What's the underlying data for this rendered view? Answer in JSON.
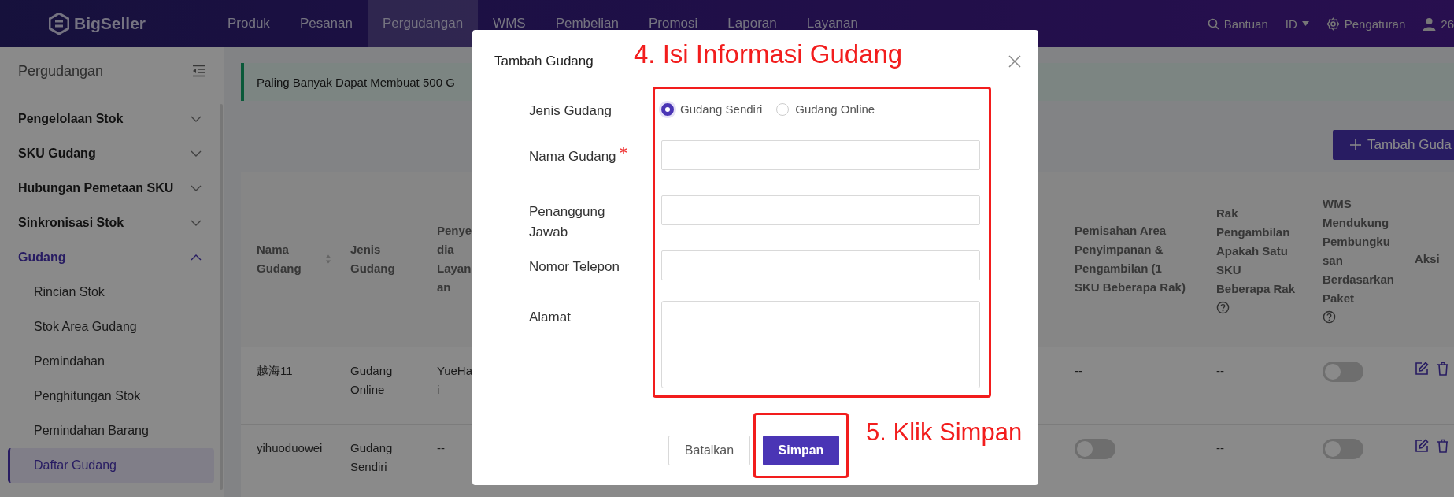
{
  "brand": {
    "name": "BigSeller"
  },
  "nav": [
    {
      "label": "Produk",
      "selected": false
    },
    {
      "label": "Pesanan",
      "selected": false
    },
    {
      "label": "Pergudangan",
      "selected": true
    },
    {
      "label": "WMS",
      "selected": false
    },
    {
      "label": "Pembelian",
      "selected": false
    },
    {
      "label": "Promosi",
      "selected": false
    },
    {
      "label": "Laporan",
      "selected": false
    },
    {
      "label": "Layanan",
      "selected": false
    }
  ],
  "header_tools": {
    "help": "Bantuan",
    "language": "ID",
    "settings": "Pengaturan",
    "user": "26"
  },
  "sidebar": {
    "title": "Pergudangan",
    "items": [
      {
        "label": "Pengelolaan Stok",
        "expanded": false
      },
      {
        "label": "SKU Gudang",
        "expanded": false
      },
      {
        "label": "Hubungan Pemetaan SKU",
        "expanded": false
      },
      {
        "label": "Sinkronisasi Stok",
        "expanded": false
      },
      {
        "label": "Gudang",
        "expanded": true,
        "children": [
          {
            "label": "Rincian Stok",
            "selected": false
          },
          {
            "label": "Stok Area Gudang",
            "selected": false
          },
          {
            "label": "Pemindahan",
            "selected": false
          },
          {
            "label": "Penghitungan Stok",
            "selected": false
          },
          {
            "label": "Pemindahan Barang",
            "selected": false
          },
          {
            "label": "Daftar Gudang",
            "selected": true
          }
        ]
      }
    ]
  },
  "alert": "Paling Banyak Dapat Membuat 500 G",
  "add_button": "Tambah Guda",
  "table": {
    "columns": [
      {
        "label": "Nama Gudang",
        "kind": "sortable"
      },
      {
        "label": "Jenis Gudang",
        "kind": "plain"
      },
      {
        "label": "Penyedia Layanan",
        "kind": "plain"
      },
      {
        "label": "Pemisahan Area Penyimpanan & Pengambilan (1 SKU Beberapa Rak)",
        "kind": "plain"
      },
      {
        "label": "Rak Pengambilan Apakah Satu SKU Beberapa Rak",
        "kind": "help"
      },
      {
        "label": "WMS Mendukung Pembungkusan Berdasarkan Paket",
        "kind": "help"
      },
      {
        "label": "Aksi",
        "kind": "plain"
      }
    ],
    "rows": [
      {
        "cells": [
          {
            "kind": "text",
            "text": "越海11"
          },
          {
            "kind": "text",
            "text": "Gudang Online"
          },
          {
            "kind": "text",
            "text": "YueHai"
          },
          {
            "kind": "text",
            "text": "--"
          },
          {
            "kind": "text",
            "text": "--"
          },
          {
            "kind": "toggle",
            "on": false
          },
          {
            "kind": "actions"
          }
        ]
      },
      {
        "cells": [
          {
            "kind": "text",
            "text": "yihuoduowei"
          },
          {
            "kind": "text",
            "text": "Gudang Sendiri"
          },
          {
            "kind": "text",
            "text": "--"
          },
          {
            "kind": "toggle",
            "on": false
          },
          {
            "kind": "text",
            "text": "--"
          },
          {
            "kind": "toggle",
            "on": false
          },
          {
            "kind": "actions"
          }
        ]
      }
    ]
  },
  "dialog": {
    "title": "Tambah Gudang",
    "fields": [
      {
        "kind": "radio",
        "label": "Jenis Gudang",
        "required": false,
        "options": [
          {
            "label": "Gudang Sendiri",
            "selected": true
          },
          {
            "label": "Gudang Online",
            "selected": false
          }
        ]
      },
      {
        "kind": "input",
        "label": "Nama Gudang",
        "required": true
      },
      {
        "kind": "input",
        "label": "Penanggung Jawab",
        "required": false
      },
      {
        "kind": "input",
        "label": "Nomor Telepon",
        "required": false
      },
      {
        "kind": "textarea",
        "label": "Alamat",
        "required": false
      }
    ],
    "buttons": [
      {
        "label": "Batalkan",
        "kind": "secondary"
      },
      {
        "label": "Simpan",
        "kind": "primary"
      }
    ]
  },
  "annotations": [
    {
      "text": "4. Isi Informasi Gudang"
    },
    {
      "text": "5. Klik Simpan"
    }
  ]
}
